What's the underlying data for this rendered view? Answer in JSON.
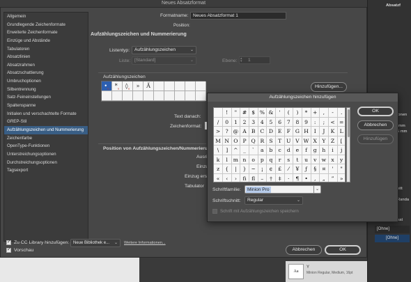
{
  "window_title": "Neues Absatzformat",
  "sidebar": {
    "items": [
      {
        "label": "Allgemein"
      },
      {
        "label": "Grundlegende Zeichenformate"
      },
      {
        "label": "Erweiterte Zeichenformate"
      },
      {
        "label": "Einzüge und Abstände"
      },
      {
        "label": "Tabulatoren"
      },
      {
        "label": "Absatzlinien"
      },
      {
        "label": "Absatzrahmen"
      },
      {
        "label": "Absatzschattierung"
      },
      {
        "label": "Umbruchoptionen"
      },
      {
        "label": "Silbentrennung"
      },
      {
        "label": "Satz-Feineinstellungen"
      },
      {
        "label": "Spaltenspanne"
      },
      {
        "label": "Initialen und verschachtelte Formate"
      },
      {
        "label": "GREP-Stil"
      },
      {
        "label": "Aufzählungszeichen und Nummerierung"
      },
      {
        "label": "Zeichenfarbe"
      },
      {
        "label": "OpenType-Funktionen"
      },
      {
        "label": "Unterstreichungsoptionen"
      },
      {
        "label": "Durchstreichungsoptionen"
      },
      {
        "label": "Tagsexport"
      }
    ],
    "selected_index": 14
  },
  "main": {
    "format_name_label": "Formatname:",
    "format_name_value": "Neues Absatzformat 1",
    "position_label": "Position:",
    "section_title": "Aufzählungszeichen und Nummerierung",
    "listtype_label": "Listentyp:",
    "listtype_value": "Aufzählungszeichen",
    "list_label": "Liste:",
    "list_value": "[Standard]",
    "level_label": "Ebene:",
    "level_value": "1",
    "bullets_label": "Aufzählungszeichen",
    "bullets": [
      {
        "glyph": "•",
        "font_tag": "u"
      },
      {
        "glyph": "*",
        "font_tag": "u"
      },
      {
        "glyph": "◊",
        "font_tag": "u"
      },
      {
        "glyph": "»",
        "font_tag": ""
      },
      {
        "glyph": "Ӑ",
        "font_tag": ""
      }
    ],
    "add_button": "Hinzufügen...",
    "text_after_label": "Text danach:",
    "char_format_label": "Zeichenformat:",
    "position_section_title": "Position von Aufzählungszeichen/Nummerierung",
    "align_label": "Ausri",
    "indent_label": "Einzu",
    "first_indent_label": "Einzug ers",
    "tab_label": "Tabulator"
  },
  "footer": {
    "cc_label": "Zu CC Library hinzufügen:",
    "cc_checked": true,
    "cc_select": "Neue Bibliothek e...",
    "more_info_link": "Weitere Informationen...",
    "preview_label": "Vorschau",
    "preview_checked": true,
    "cancel": "Abbrechen",
    "ok": "OK"
  },
  "add_dialog": {
    "title": "Aufzählungszeichen hinzufügen",
    "ok": "OK",
    "cancel": "Abbrechen",
    "add": "Hinzufügen",
    "glyph_rows": [
      [
        "",
        "!",
        "\"",
        "#",
        "$",
        "%",
        "&",
        "'",
        "(",
        ")",
        "*",
        "+",
        ",",
        "-",
        "."
      ],
      [
        "/",
        "0",
        "1",
        "2",
        "3",
        "4",
        "5",
        "6",
        "7",
        "8",
        "9",
        ":",
        ";",
        "<",
        "="
      ],
      [
        ">",
        "?",
        "@",
        "A",
        "B",
        "C",
        "D",
        "E",
        "F",
        "G",
        "H",
        "I",
        "J",
        "K",
        "L"
      ],
      [
        "M",
        "N",
        "O",
        "P",
        "Q",
        "R",
        "S",
        "T",
        "U",
        "V",
        "W",
        "X",
        "Y",
        "Z",
        "["
      ],
      [
        "\\",
        "]",
        "^",
        "_",
        "`",
        "a",
        "b",
        "c",
        "d",
        "e",
        "f",
        "g",
        "h",
        "i",
        "j"
      ],
      [
        "k",
        "l",
        "m",
        "n",
        "o",
        "p",
        "q",
        "r",
        "s",
        "t",
        "u",
        "v",
        "w",
        "x",
        "y"
      ],
      [
        "z",
        "{",
        "|",
        "}",
        "~",
        "¡",
        "¢",
        "£",
        "⁄",
        "¥",
        "ƒ",
        "§",
        "¤",
        "'",
        "\""
      ],
      [
        "«",
        "‹",
        "›",
        "ﬁ",
        "ﬂ",
        "–",
        "†",
        "‡",
        "·",
        "¶",
        "•",
        "‚",
        "„",
        "”",
        "»"
      ]
    ],
    "font_family_label": "Schriftfamilie:",
    "font_family_value": "Minion Pro",
    "font_style_label": "Schriftschnitt:",
    "font_style_value": "Regular",
    "remember_label": "Schrift mit Aufzählungszeichen speichern"
  },
  "right_panel": {
    "title": "Absatzf",
    "text1": "ionen",
    "text2": "mm",
    "text3": "5 mm",
    "text4": "nitt",
    "text5": "Randa",
    "text6": "nat",
    "none1": "[Ohne]",
    "none2": "[Ohne]"
  },
  "bottom": {
    "thumb_label": "Aa",
    "thumb_caption": "Y",
    "thumb_sub": "Minion Regular, Medium, 16pt"
  }
}
